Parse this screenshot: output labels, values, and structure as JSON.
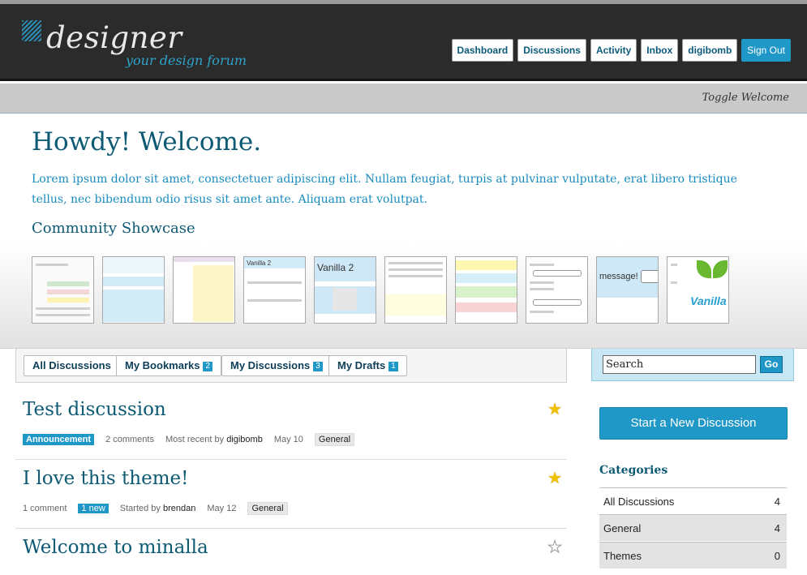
{
  "header": {
    "logo_title": "designer",
    "logo_subtitle": "your design forum",
    "nav": [
      "Dashboard",
      "Discussions",
      "Activity",
      "Inbox",
      "digibomb"
    ],
    "sign_out": "Sign Out"
  },
  "toggle_welcome": "Toggle Welcome",
  "welcome": {
    "title": "Howdy! Welcome.",
    "text": "Lorem ipsum dolor sit amet, consectetuer adipiscing elit. Nullam feugiat, turpis at pulvinar vulputate, erat libero tristique tellus, nec bibendum odio risus sit amet ante. Aliquam erat volutpat.",
    "showcase_title": "Community Showcase",
    "thumbnails": [
      {
        "label": ""
      },
      {
        "label": ""
      },
      {
        "label": ""
      },
      {
        "label": "Vanilla 2"
      },
      {
        "label": "Vanilla 2"
      },
      {
        "label": ""
      },
      {
        "label": ""
      },
      {
        "label": ""
      },
      {
        "label": "message!"
      },
      {
        "label": "Vanilla"
      }
    ]
  },
  "filters": {
    "all": "All Discussions",
    "bookmarks": "My Bookmarks",
    "bookmarks_count": "2",
    "mine": "My Discussions",
    "mine_count": "3",
    "drafts": "My Drafts",
    "drafts_count": "1"
  },
  "discussions": [
    {
      "title": "Test discussion",
      "announcement": "Announcement",
      "comments": "2 comments",
      "recent_label": "Most recent by",
      "user": "digibomb",
      "date": "May 10",
      "category": "General",
      "bookmarked": true
    },
    {
      "title": "I love this theme!",
      "comments": "1 comment",
      "new": "1 new",
      "recent_label": "Started by",
      "user": "brendan",
      "date": "May 12",
      "category": "General",
      "bookmarked": true
    },
    {
      "title": "Welcome to minalla",
      "bookmarked": false
    }
  ],
  "sidebar": {
    "search_value": "Search",
    "go": "Go",
    "new_discussion": "Start a New Discussion",
    "categories_title": "Categories",
    "categories": [
      {
        "name": "All Discussions",
        "count": "4"
      },
      {
        "name": "General",
        "count": "4"
      },
      {
        "name": "Themes",
        "count": "0"
      }
    ]
  },
  "colors": {
    "accent": "#1f97c7",
    "heading": "#0d5a74",
    "header_bg": "#2b2b2b",
    "star": "#f2c200"
  },
  "icons": [
    "logo-mark-icon",
    "star-icon",
    "user-icon"
  ]
}
